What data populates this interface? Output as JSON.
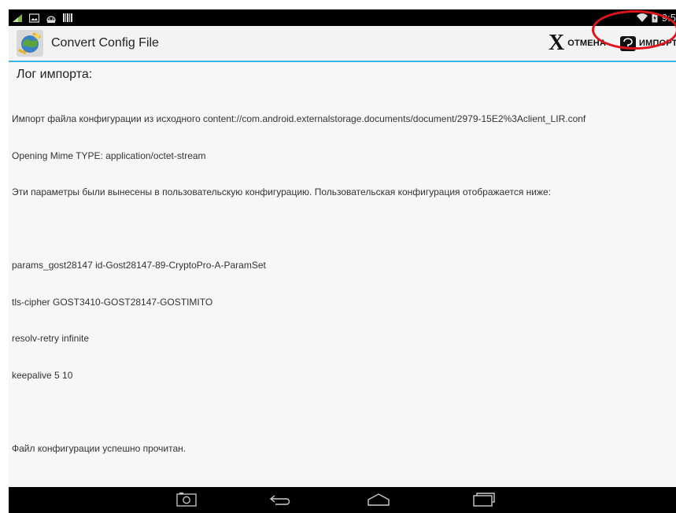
{
  "statusbar": {
    "clock": "9:5",
    "left_icons": [
      "signal-icon",
      "image-icon",
      "android-icon",
      "barcode-icon"
    ],
    "right_icons": [
      "wifi-icon",
      "battery-icon"
    ]
  },
  "actionbar": {
    "title": "Convert Config File",
    "cancel_label": "ОТМЕНА",
    "import_label": "ИМПОРТ",
    "accent_color": "#33b5e5",
    "highlight_color": "#e0141b"
  },
  "log": {
    "title": "Лог импорта:",
    "lines": [
      "Импорт файла конфигурации из исходного content://com.android.externalstorage.documents/document/2979-15E2%3Aclient_LIR.conf",
      "Opening Mime TYPE: application/octet-stream",
      "Эти параметры были вынесены в пользовательскую конфигурацию. Пользовательская конфигурация отображается ниже:",
      "",
      "params_gost28147 id-Gost28147-89-CryptoPro-A-ParamSet",
      "tls-cipher GOST3410-GOST28147-GOSTIMITO",
      "resolv-retry infinite",
      "keepalive 5 10",
      "",
      "Файл конфигурации успешно прочитан."
    ]
  },
  "navbar": {
    "buttons": [
      "camera-icon",
      "back-icon",
      "home-icon",
      "recents-icon"
    ]
  }
}
